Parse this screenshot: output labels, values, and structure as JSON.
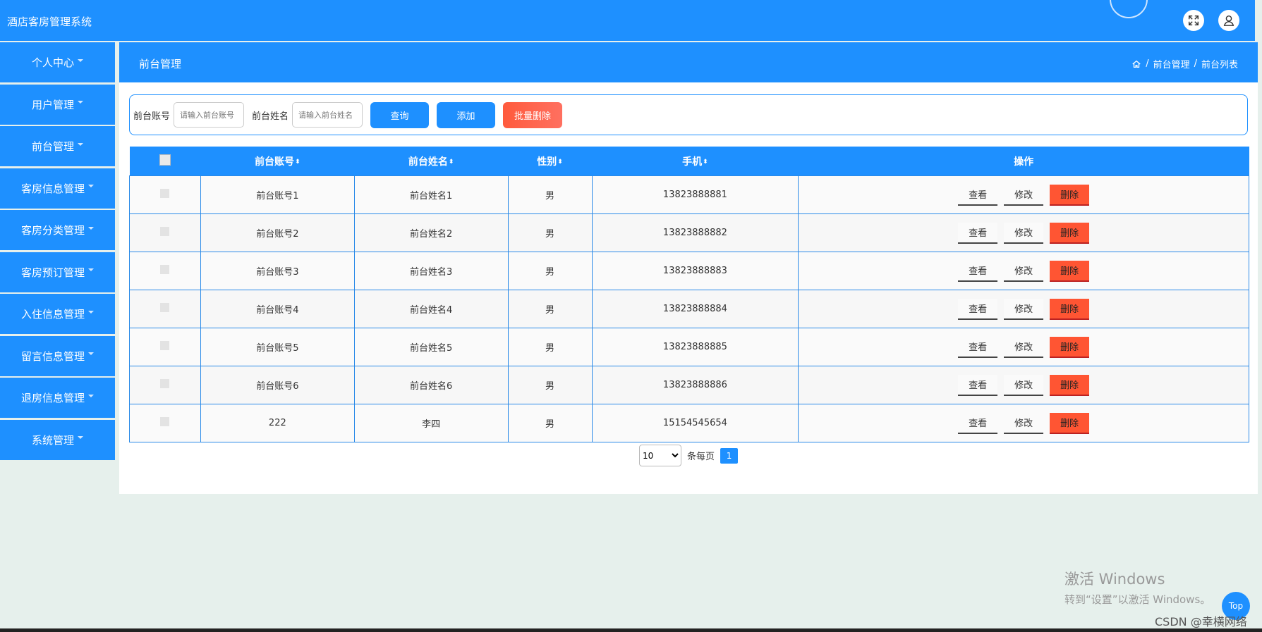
{
  "app": {
    "title": "酒店客房管理系统"
  },
  "sidebar": {
    "items": [
      {
        "label": "个人中心"
      },
      {
        "label": "用户管理"
      },
      {
        "label": "前台管理"
      },
      {
        "label": "客房信息管理"
      },
      {
        "label": "客房分类管理"
      },
      {
        "label": "客房预订管理"
      },
      {
        "label": "入住信息管理"
      },
      {
        "label": "留言信息管理"
      },
      {
        "label": "退房信息管理"
      },
      {
        "label": "系统管理"
      }
    ]
  },
  "page": {
    "title": "前台管理",
    "breadcrumb": [
      "前台管理",
      "前台列表"
    ],
    "breadcrumb_sep": "/"
  },
  "search": {
    "account_label": "前台账号",
    "account_placeholder": "请输入前台账号",
    "name_label": "前台姓名",
    "name_placeholder": "请输入前台姓名",
    "query_button": "查询",
    "add_button": "添加",
    "batch_delete_button": "批量删除"
  },
  "table": {
    "headers": [
      "前台账号",
      "前台姓名",
      "性别",
      "手机",
      "操作"
    ],
    "sort_glyph": "⬍",
    "actions": {
      "view": "查看",
      "edit": "修改",
      "delete": "删除"
    },
    "rows": [
      {
        "account": "前台账号1",
        "name": "前台姓名1",
        "gender": "男",
        "phone": "13823888881"
      },
      {
        "account": "前台账号2",
        "name": "前台姓名2",
        "gender": "男",
        "phone": "13823888882"
      },
      {
        "account": "前台账号3",
        "name": "前台姓名3",
        "gender": "男",
        "phone": "13823888883"
      },
      {
        "account": "前台账号4",
        "name": "前台姓名4",
        "gender": "男",
        "phone": "13823888884"
      },
      {
        "account": "前台账号5",
        "name": "前台姓名5",
        "gender": "男",
        "phone": "13823888885"
      },
      {
        "account": "前台账号6",
        "name": "前台姓名6",
        "gender": "男",
        "phone": "13823888886"
      },
      {
        "account": "222",
        "name": "李四",
        "gender": "男",
        "phone": "15154545654"
      }
    ]
  },
  "pagination": {
    "page_size": "10",
    "per_page_label": "条每页",
    "current_page": "1"
  },
  "overlay": {
    "win_title": "激活 Windows",
    "win_sub": "转到“设置”以激活 Windows。",
    "top_label": "Top",
    "csdn": "CSDN @幸横网络"
  },
  "colors": {
    "primary": "#1e90ff",
    "danger": "#ff5533"
  },
  "icons": {
    "fullscreen": "expand-icon",
    "user": "user-icon",
    "home": "home-icon"
  }
}
